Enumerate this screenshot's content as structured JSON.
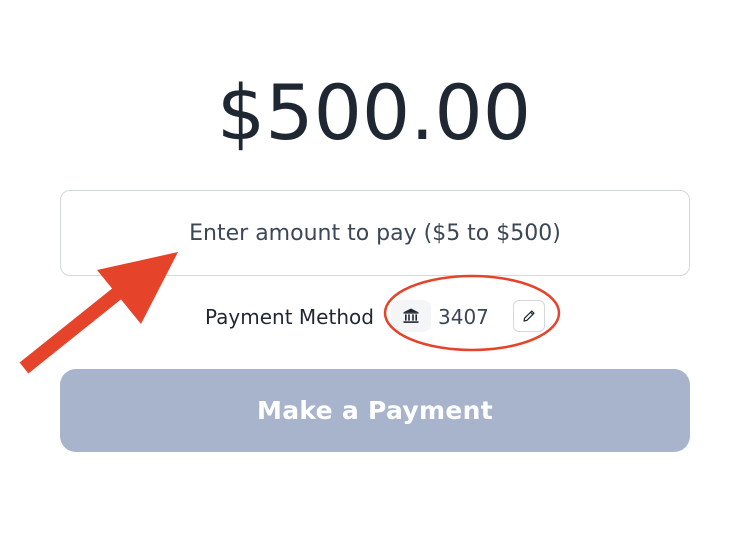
{
  "balance": {
    "amount": "$500.00"
  },
  "payment_form": {
    "amount_placeholder": "Enter amount to pay ($5 to $500)",
    "amount_value": ""
  },
  "payment_method": {
    "label": "Payment Method",
    "icon": "bank-icon",
    "account_last4": "3407",
    "edit_icon": "pencil-icon"
  },
  "actions": {
    "submit_label": "Make a Payment",
    "submit_enabled": false
  },
  "colors": {
    "text_primary": "#1f2733",
    "input_border": "#d4d8de",
    "button_disabled": "#a7b4cc",
    "annotation_red": "#e5432a"
  }
}
